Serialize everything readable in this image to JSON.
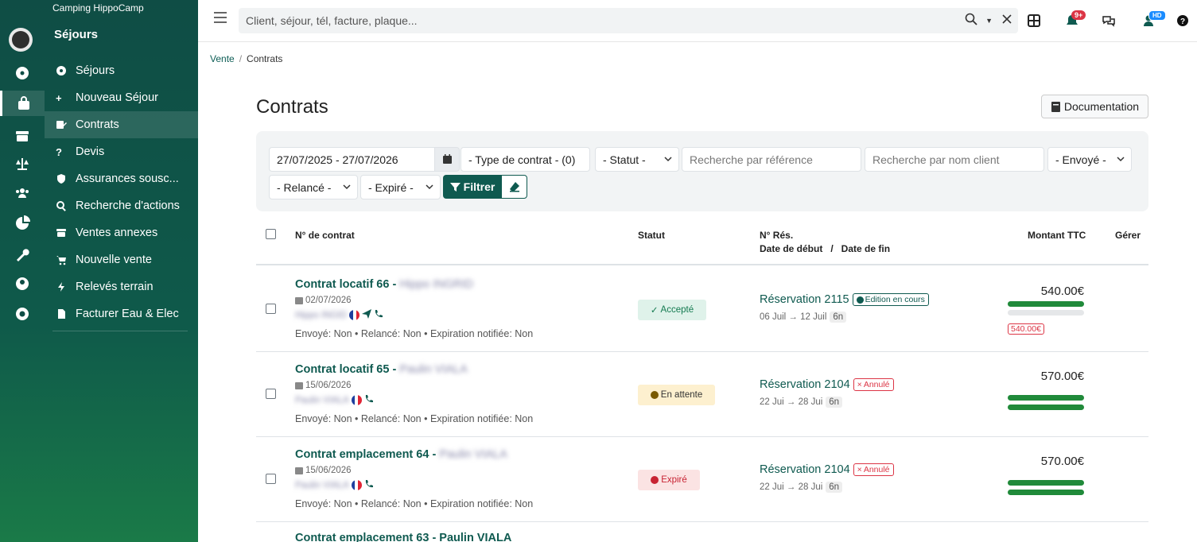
{
  "app": {
    "camping_name": "Camping HippoCamp",
    "section": "Séjours"
  },
  "sidebar": {
    "items": [
      {
        "label": "Séjours",
        "icon": "circle-dot-icon"
      },
      {
        "label": "Nouveau Séjour",
        "icon": "plus-icon"
      },
      {
        "label": "Contrats",
        "icon": "signature-icon",
        "active": true
      },
      {
        "label": "Devis",
        "icon": "question-icon"
      },
      {
        "label": "Assurances sousc...",
        "icon": "shield-icon"
      },
      {
        "label": "Recherche d'actions",
        "icon": "search-icon"
      },
      {
        "label": "Ventes annexes",
        "icon": "box-icon"
      },
      {
        "label": "Nouvelle vente",
        "icon": "cart-icon"
      },
      {
        "label": "Relevés terrain",
        "icon": "bolt-icon"
      },
      {
        "label": "Facturer Eau & Elec",
        "icon": "file-icon"
      }
    ]
  },
  "topbar": {
    "search_placeholder": "Client, séjour, tél, facture, plaque...",
    "notifications_badge": "9+",
    "user_initials": "HD"
  },
  "breadcrumb": {
    "parent": "Vente",
    "current": "Contrats"
  },
  "page": {
    "title": "Contrats",
    "doc_button": "Documentation"
  },
  "filters": {
    "date_range": "27/07/2025 - 27/07/2026",
    "contract_type": "- Type de contrat - (0)",
    "status": "- Statut -",
    "ref_placeholder": "Recherche par référence",
    "client_placeholder": "Recherche par nom client",
    "sent": "- Envoyé -",
    "reminded": "- Relancé -",
    "expired": "- Expiré -",
    "filter_button": "Filtrer"
  },
  "table": {
    "headers": {
      "contract_no": "N° de contrat",
      "status": "Statut",
      "resa_no": "N° Rés.",
      "dates": "Date de début   /   Date de fin",
      "amount": "Montant TTC",
      "manage": "Gérer"
    },
    "rows": [
      {
        "title": "Contrat locatif 66 - ",
        "client_name": "Hippo INGRID",
        "date": "02/07/2026",
        "client_short": "Hippo INGID",
        "flags": "Envoyé: Non • Relancé: Non • Expiration notifiée: Non",
        "status": "Accepté",
        "resa": "Réservation 2115",
        "resa_badge": "Edition en cours",
        "resa_dates": "06 Juil → 12 Juil",
        "nights": "6n",
        "amount": "540.00€",
        "amount_tag": "540.00€"
      },
      {
        "title": "Contrat locatif 65 - ",
        "client_name": "Paulin VIALA",
        "date": "15/06/2026",
        "client_short": "Paulin VIALA",
        "flags": "Envoyé: Non • Relancé: Non • Expiration notifiée: Non",
        "status": "En attente",
        "resa": "Réservation 2104",
        "resa_badge": "Annulé",
        "resa_dates": "22 Jui → 28 Jui",
        "nights": "6n",
        "amount": "570.00€"
      },
      {
        "title": "Contrat emplacement 64 - ",
        "client_name": "Paulin VIALA",
        "date": "15/06/2026",
        "client_short": "Paulin VIALA",
        "flags": "Envoyé: Non • Relancé: Non • Expiration notifiée: Non",
        "status": "Expiré",
        "resa": "Réservation 2104",
        "resa_badge": "Annulé",
        "resa_dates": "22 Jui → 28 Jui",
        "nights": "6n",
        "amount": "570.00€"
      },
      {
        "title": "Contrat emplacement 63 - Paulin VIALA"
      }
    ]
  },
  "colors": {
    "brand": "#0f5a50",
    "accent_green": "#208a3a",
    "danger": "#dc3545"
  }
}
